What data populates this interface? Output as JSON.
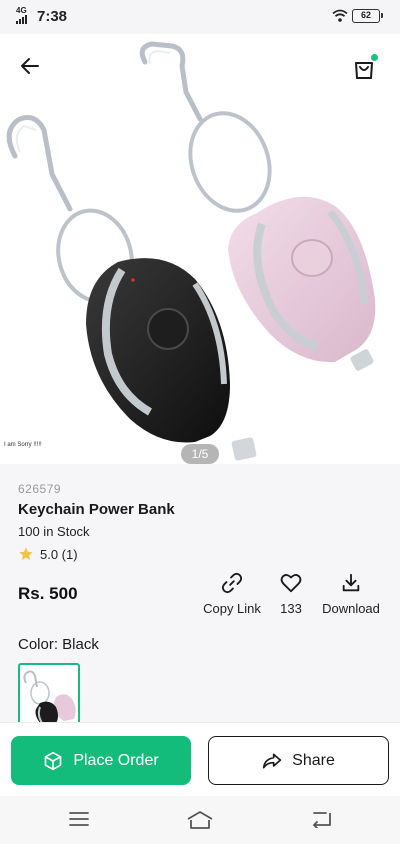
{
  "status_bar": {
    "network": "4G",
    "time": "7:38",
    "battery": "62"
  },
  "product": {
    "sku": "626579",
    "title": "Keychain Power Bank",
    "stock": "100 in Stock",
    "rating": "5.0 (1)",
    "price": "Rs. 500",
    "image_caption": "I am Sorry !!!!!",
    "pager": "1/5"
  },
  "actions": {
    "copy_link": "Copy Link",
    "likes": "133",
    "download": "Download"
  },
  "color": {
    "label": "Color: Black"
  },
  "buttons": {
    "place_order": "Place Order",
    "share": "Share"
  },
  "colors": {
    "accent": "#14bc7c",
    "star": "#f3c24a"
  },
  "icons": [
    "back-arrow-icon",
    "shopping-bag-icon",
    "link-icon",
    "heart-icon",
    "download-icon",
    "box-icon",
    "share-arrow-icon",
    "menu-icon",
    "home-icon",
    "back-nav-icon",
    "star-icon",
    "wifi-icon",
    "signal-icon"
  ]
}
